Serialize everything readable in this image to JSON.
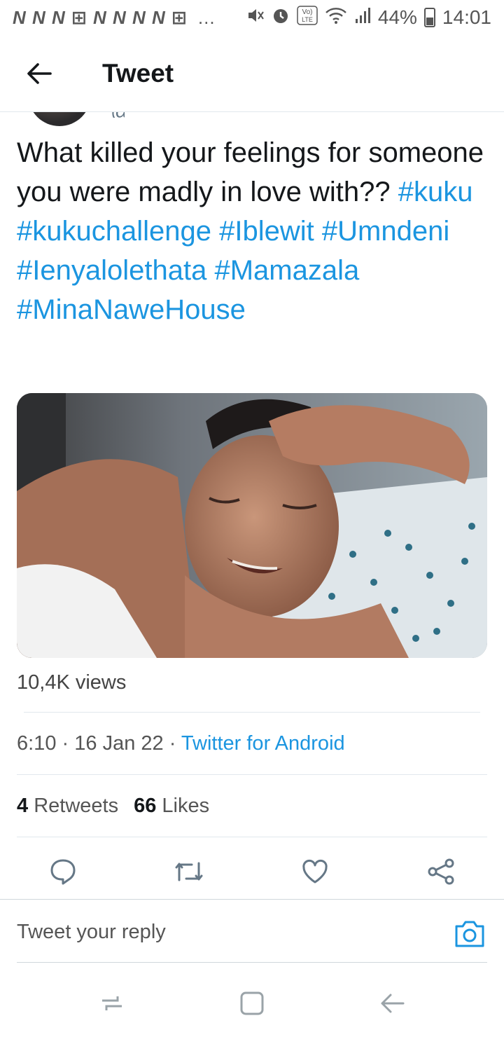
{
  "status_bar": {
    "notification_icons": "N N N ⊞ N N N N ⊞",
    "more": "…",
    "battery_percent": "44%",
    "time": "14:01",
    "battery_level": 0.44
  },
  "header": {
    "title": "Tweet"
  },
  "tweet": {
    "text_prefix": "What killed your feelings for someone you were madly in love with??",
    "hashtags": [
      "#kuku",
      "#kukuchallenge",
      "#Iblewit",
      "#Umndeni",
      "#Ienyalolethata",
      "#Mamazala",
      "#MinaNaweHouse"
    ],
    "views": "10,4K views",
    "time": "6:10",
    "date": "16 Jan 22",
    "separator": "·",
    "source": "Twitter for Android",
    "retweets_count": "4",
    "retweets_label": "Retweets",
    "likes_count": "66",
    "likes_label": "Likes"
  },
  "reply": {
    "placeholder": "Tweet your reply"
  },
  "colors": {
    "link": "#1b95e0",
    "text": "#14171a",
    "secondary": "#555555",
    "icon": "#657786",
    "divider": "#e1e8ed"
  }
}
